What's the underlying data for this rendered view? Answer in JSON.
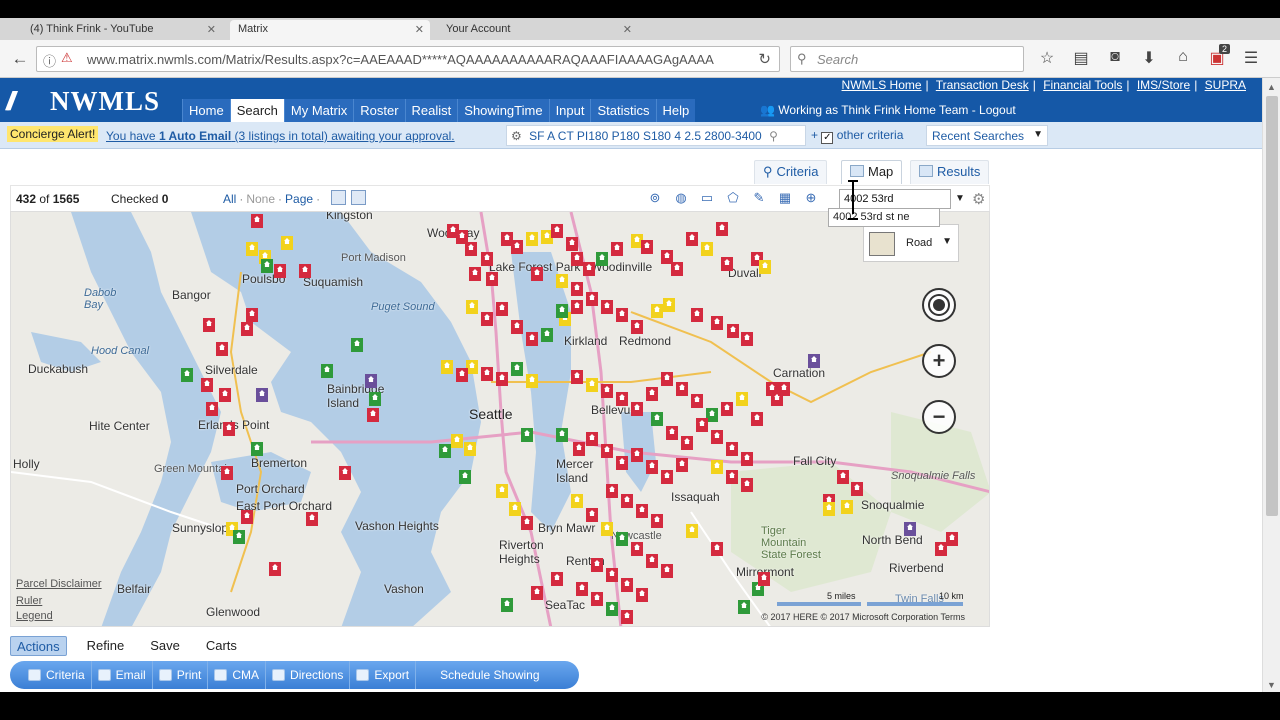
{
  "browser": {
    "tabs": [
      {
        "label": "(4) Think Frink - YouTube"
      },
      {
        "label": "Matrix"
      },
      {
        "label": "Your Account"
      }
    ],
    "url": "www.matrix.nwmls.com/Matrix/Results.aspx?c=AAEAAAD*****AQAAAAAAAAAARAQAAAFIAAAAGAgAAAA",
    "search_placeholder": "Search",
    "notification_count": "2"
  },
  "header": {
    "logo_text": "NWMLS",
    "top_links": [
      "NWMLS Home",
      "Transaction Desk",
      "Financial Tools",
      "IMS/Store",
      "SUPRA"
    ],
    "nav": [
      "Home",
      "Search",
      "My Matrix",
      "Roster",
      "Realist",
      "ShowingTime",
      "Input",
      "Statistics",
      "Help"
    ],
    "active_nav": "Search",
    "working_as": "Working as Think Frink Home Team - Logout"
  },
  "concierge": {
    "alert_label": "Concierge Alert!",
    "message_prefix": "You have ",
    "message_bold": "1 Auto Email",
    "message_suffix": " (3 listings in total) awaiting your approval.",
    "criteria_text": "SF A CT PI180 P180 S180 4 2.5 2800-3400",
    "other_criteria": "other criteria",
    "recent_searches": "Recent Searches"
  },
  "view_tabs": [
    "Criteria",
    "Map",
    "Results"
  ],
  "active_view": "Map",
  "results": {
    "shown": "432",
    "of_label": "of",
    "total": "1565",
    "checked_label": "Checked",
    "checked_count": "0",
    "select_all": "All",
    "select_none": "None",
    "select_page": "Page"
  },
  "map": {
    "address_input": "4002 53rd",
    "suggestion": "4002 53rd st ne",
    "map_type": "Road",
    "links": [
      "Parcel Disclaimer",
      "Ruler",
      "Legend"
    ],
    "scale_miles": "5 miles",
    "scale_km": "10 km",
    "copyright": "© 2017 HERE © 2017 Microsoft Corporation Terms",
    "places": [
      "Kingston",
      "Woodway",
      "Port Madison",
      "Poulsbo",
      "Suquamish",
      "Bangor",
      "Puget Sound",
      "Duckabush",
      "Silverdale",
      "Hood Canal",
      "Bainbridge Island",
      "Seattle",
      "Kirkland",
      "Redmond",
      "Bellevue",
      "Mercer Island",
      "Hite Center",
      "Erlands Point",
      "Holly",
      "Bremerton",
      "Green Mountain",
      "Port Orchard",
      "East Port Orchard",
      "Sunnyslop",
      "Vashon Heights",
      "Vashon",
      "Bryn Mawr",
      "Riverton Heights",
      "Renton",
      "SeaTac",
      "Belfair",
      "Glenwood",
      "Lake Forest Park",
      "Woodinville",
      "Duvall",
      "Carnation",
      "Fall City",
      "Snoqualmie",
      "Snoqualmie Falls",
      "Issaquah",
      "North Bend",
      "Riverbend",
      "Mirrormont",
      "Tiger Mountain State Forest",
      "Dabob Bay",
      "Newcastle",
      "Twin Falls"
    ]
  },
  "actions": {
    "tabs": [
      "Actions",
      "Refine",
      "Save",
      "Carts"
    ],
    "buttons": [
      "Criteria",
      "Email",
      "Print",
      "CMA",
      "Directions",
      "Export",
      "Schedule Showing"
    ]
  },
  "colors": {
    "brand_blue": "#1558a7",
    "pin_red": "#d42a3f",
    "pin_yellow": "#f2d21c",
    "pin_green": "#2f9a3a",
    "pin_purple": "#6a4f9b"
  }
}
